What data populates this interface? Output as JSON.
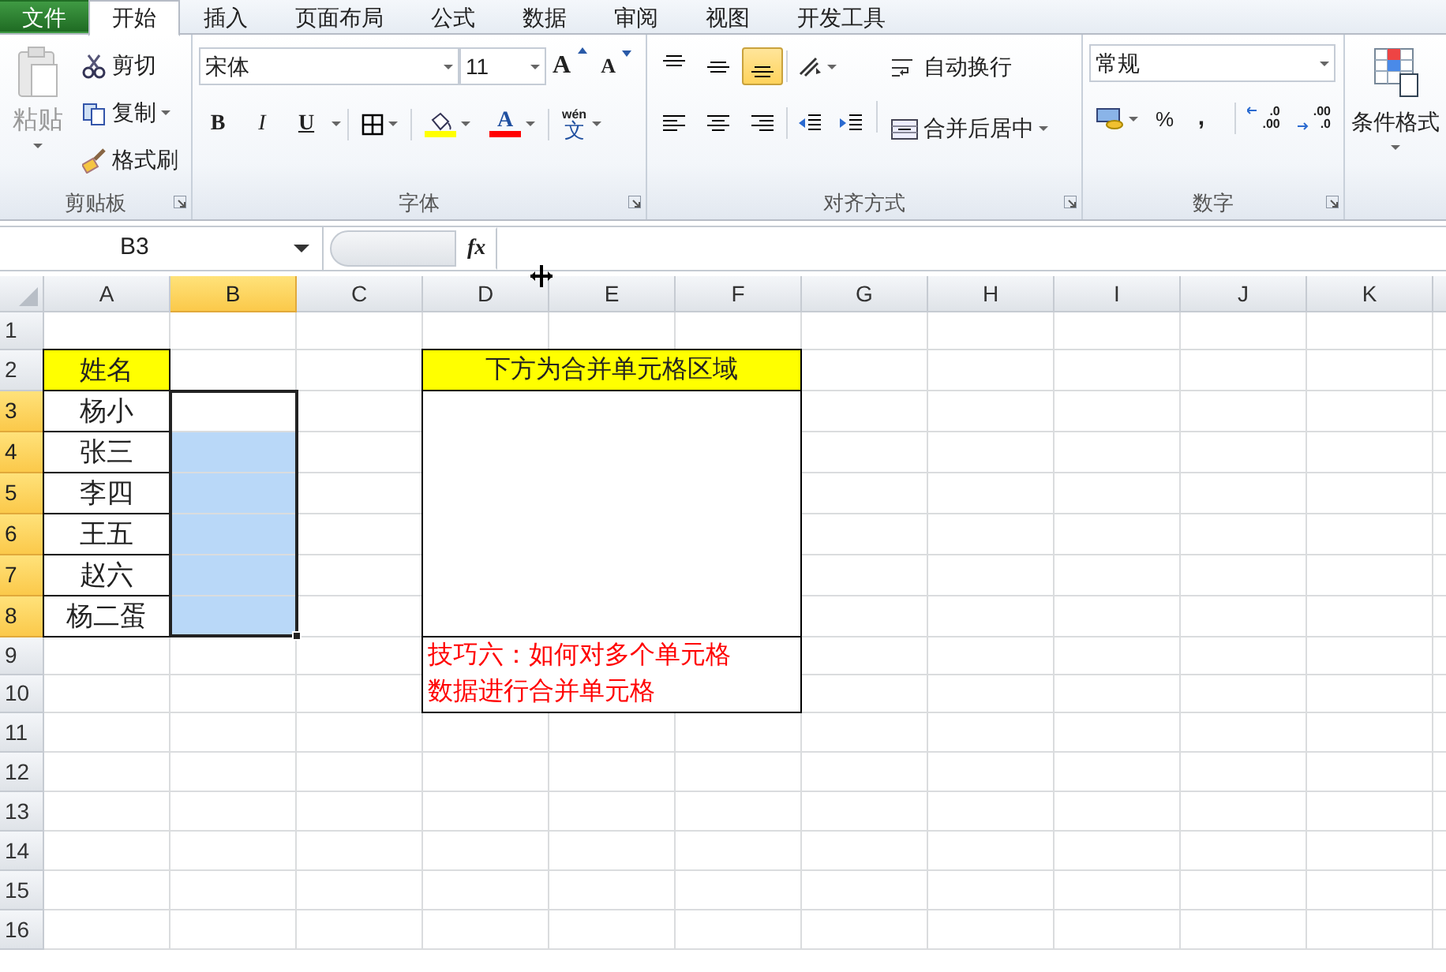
{
  "ribbon_tabs": [
    {
      "label": "文件",
      "kind": "file",
      "selected": false
    },
    {
      "label": "开始",
      "kind": "tab",
      "selected": true
    },
    {
      "label": "插入",
      "kind": "tab",
      "selected": false
    },
    {
      "label": "页面布局",
      "kind": "tab",
      "selected": false
    },
    {
      "label": "公式",
      "kind": "tab",
      "selected": false
    },
    {
      "label": "数据",
      "kind": "tab",
      "selected": false
    },
    {
      "label": "审阅",
      "kind": "tab",
      "selected": false
    },
    {
      "label": "视图",
      "kind": "tab",
      "selected": false
    },
    {
      "label": "开发工具",
      "kind": "tab",
      "selected": false
    }
  ],
  "clipboard": {
    "paste_label": "粘贴",
    "paste_disabled": true,
    "group_label": "剪贴板",
    "buttons": [
      {
        "kind": "cut",
        "label": "剪切",
        "dropdown": false
      },
      {
        "kind": "copy",
        "label": "复制",
        "dropdown": true
      },
      {
        "kind": "format-painter",
        "label": "格式刷",
        "dropdown": false
      }
    ]
  },
  "font": {
    "font_name": "宋体",
    "font_size": "11",
    "grow_label": "A",
    "shrink_label": "A",
    "style_buttons": [
      {
        "kind": "bold",
        "label": "B"
      },
      {
        "kind": "italic",
        "label": "I"
      },
      {
        "kind": "underline",
        "label": "U"
      }
    ],
    "font_color_label": "A",
    "phonetic_ruby": "wén",
    "phonetic_label": "文",
    "group_label": "字体"
  },
  "alignment": {
    "vertical_buttons": [
      {
        "kind": "top",
        "selected": false
      },
      {
        "kind": "middle",
        "selected": false
      },
      {
        "kind": "bottom",
        "selected": true
      }
    ],
    "horizontal_buttons": [
      {
        "kind": "left",
        "selected": false
      },
      {
        "kind": "center",
        "selected": false
      },
      {
        "kind": "right",
        "selected": false
      }
    ],
    "wrap_label": "自动换行",
    "merge_label": "合并后居中",
    "group_label": "对齐方式"
  },
  "number": {
    "format": "常规",
    "percent_label": "%",
    "comma_label": ",",
    "decimal_buttons": [
      {
        "kind": "increase",
        "labels": [
          ".0",
          ".00"
        ]
      },
      {
        "kind": "decrease",
        "labels": [
          ".00",
          ".0"
        ]
      }
    ],
    "group_label": "数字"
  },
  "styles": {
    "conditional_format_label": "条件格式"
  },
  "formula_bar": {
    "name_box": "B3",
    "fx_label": "fx"
  },
  "sheet": {
    "columns": [
      {
        "label": "A",
        "selected": false
      },
      {
        "label": "B",
        "selected": true
      },
      {
        "label": "C",
        "selected": false
      },
      {
        "label": "D",
        "selected": false
      },
      {
        "label": "E",
        "selected": false
      },
      {
        "label": "F",
        "selected": false
      },
      {
        "label": "G",
        "selected": false
      },
      {
        "label": "H",
        "selected": false
      },
      {
        "label": "I",
        "selected": false
      },
      {
        "label": "J",
        "selected": false
      },
      {
        "label": "K",
        "selected": false
      }
    ],
    "rows": [
      {
        "label": "1",
        "selected": false
      },
      {
        "label": "2",
        "selected": false,
        "cells": [
          {
            "text": "姓名",
            "kind": "header"
          }
        ]
      },
      {
        "label": "3",
        "selected": true,
        "cells": [
          {
            "text": "杨小",
            "kind": "name"
          }
        ]
      },
      {
        "label": "4",
        "selected": true,
        "cells": [
          {
            "text": "张三",
            "kind": "name"
          }
        ]
      },
      {
        "label": "5",
        "selected": true,
        "cells": [
          {
            "text": "李四",
            "kind": "name"
          }
        ]
      },
      {
        "label": "6",
        "selected": true,
        "cells": [
          {
            "text": "王五",
            "kind": "name"
          }
        ]
      },
      {
        "label": "7",
        "selected": true,
        "cells": [
          {
            "text": "赵六",
            "kind": "name"
          }
        ]
      },
      {
        "label": "8",
        "selected": true,
        "cells": [
          {
            "text": "杨二蛋",
            "kind": "name"
          }
        ]
      },
      {
        "label": "9",
        "selected": false
      },
      {
        "label": "10",
        "selected": false
      },
      {
        "label": "11",
        "selected": false
      },
      {
        "label": "12",
        "selected": false
      },
      {
        "label": "13",
        "selected": false
      },
      {
        "label": "14",
        "selected": false
      },
      {
        "label": "15",
        "selected": false
      },
      {
        "label": "16",
        "selected": false
      }
    ],
    "merged": [
      {
        "kind": "header",
        "text": "下方为合并单元格区域"
      },
      {
        "kind": "empty"
      },
      {
        "kind": "note",
        "lines": [
          "技巧六：如何对多个单元格",
          "数据进行合并单元格"
        ]
      }
    ]
  }
}
